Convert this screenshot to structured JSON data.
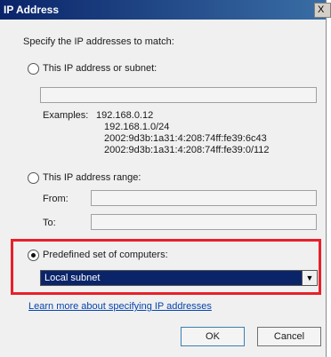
{
  "window": {
    "title": "IP Address",
    "close_glyph": "X"
  },
  "main": {
    "instruction": "Specify the IP addresses to match:",
    "option_single": "This IP address or subnet:",
    "single_value": "",
    "examples_label": "Examples:",
    "examples": [
      "192.168.0.12",
      "192.168.1.0/24",
      "2002:9d3b:1a31:4:208:74ff:fe39:6c43",
      "2002:9d3b:1a31:4:208:74ff:fe39:0/112"
    ],
    "option_range": "This IP address range:",
    "from_label": "From:",
    "to_label": "To:",
    "from_value": "",
    "to_value": "",
    "option_predefined": "Predefined set of computers:",
    "predefined_selected": "Local subnet",
    "selected_option": "predefined",
    "learn_more_link": "Learn more about specifying IP addresses"
  },
  "buttons": {
    "ok": "OK",
    "cancel": "Cancel"
  },
  "colors": {
    "highlight_border": "#e8202a",
    "title_bar": "#0a246a",
    "link": "#0645ad"
  }
}
